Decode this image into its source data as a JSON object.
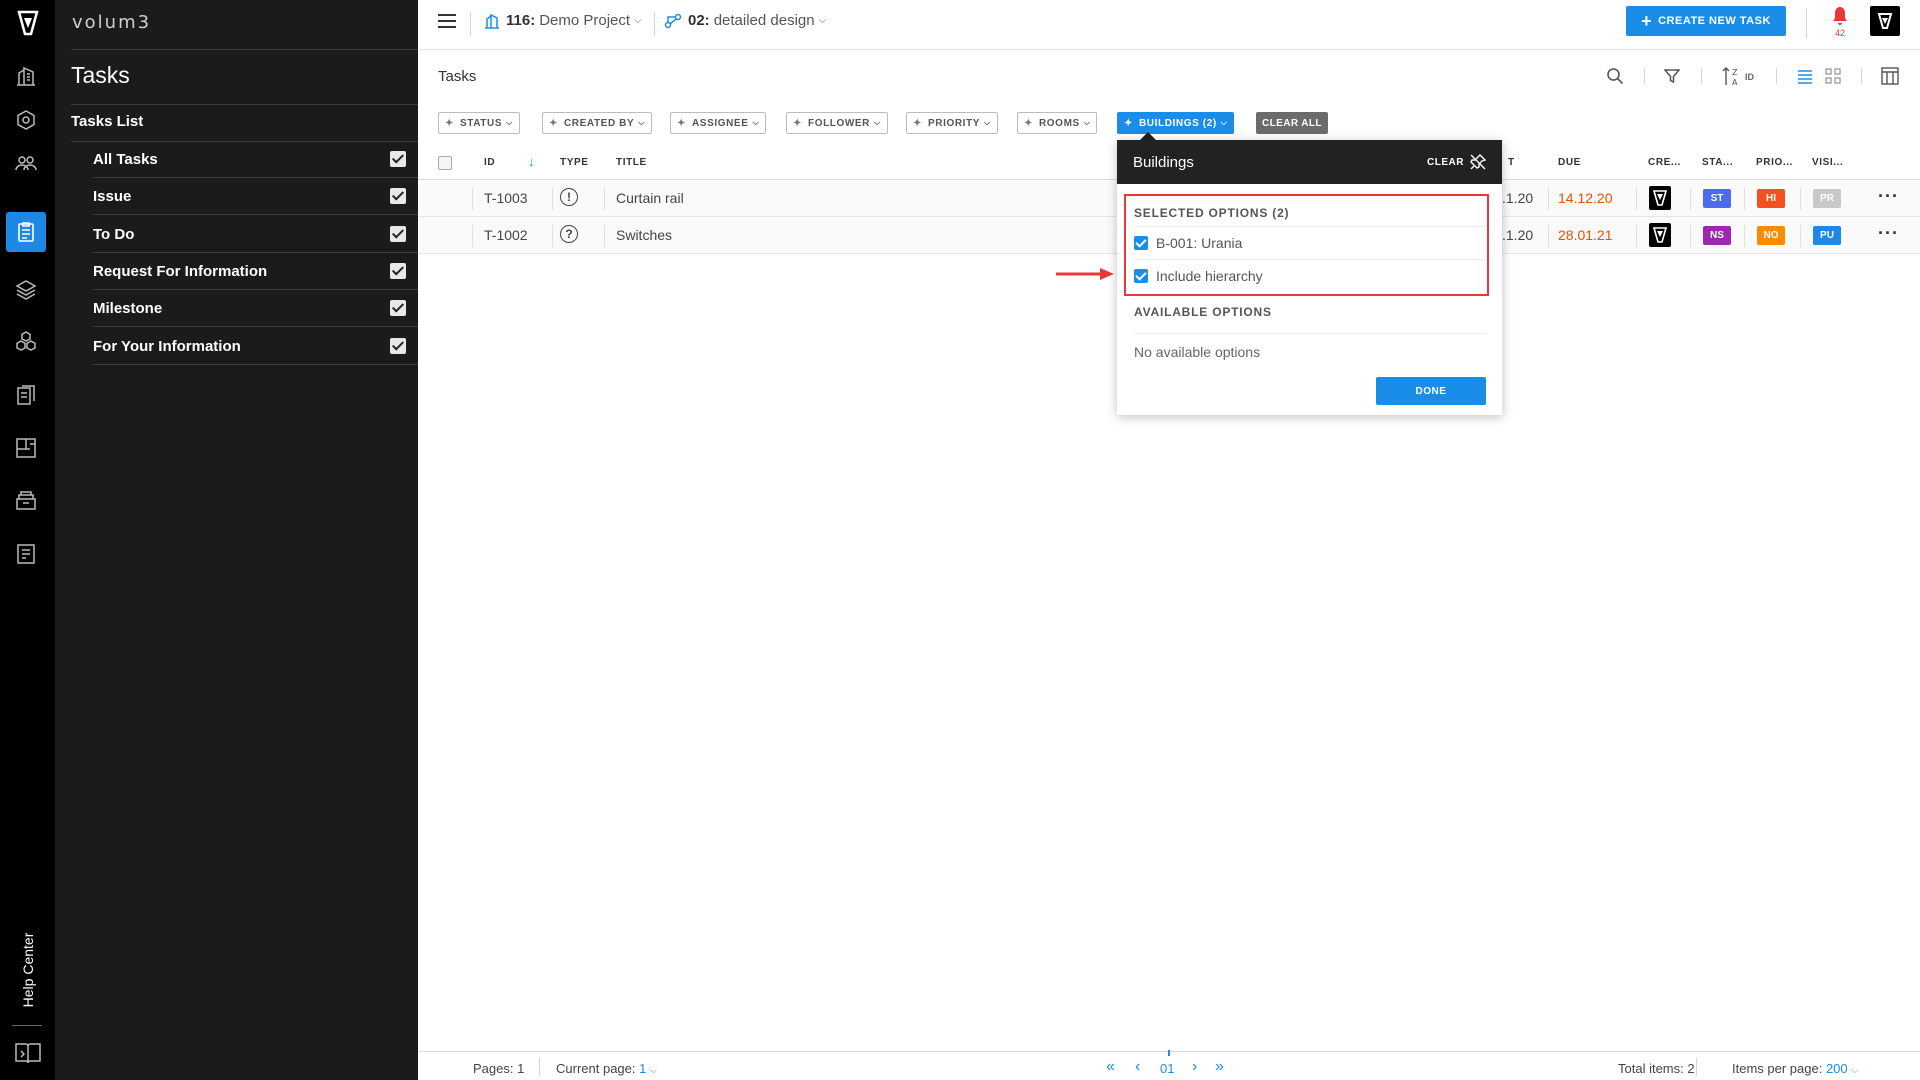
{
  "app": {
    "brand": "volum3"
  },
  "topbar": {
    "project_id": "116:",
    "project_name": "Demo Project",
    "phase_id": "02:",
    "phase_name": "detailed design",
    "create_button": "CREATE NEW TASK",
    "notification_count": "42"
  },
  "sidebar": {
    "title": "Tasks",
    "list_title": "Tasks List",
    "items": [
      {
        "label": "All Tasks"
      },
      {
        "label": "Issue"
      },
      {
        "label": "To Do"
      },
      {
        "label": "Request For Information"
      },
      {
        "label": "Milestone"
      },
      {
        "label": "For Your Information"
      }
    ],
    "help_center": "Help Center"
  },
  "main": {
    "title": "Tasks",
    "sort_label": "ID"
  },
  "filters": {
    "chips": [
      "STATUS",
      "CREATED BY",
      "ASSIGNEE",
      "FOLLOWER",
      "PRIORITY",
      "ROOMS",
      "BUILDINGS (2)"
    ],
    "clear_all": "CLEAR ALL"
  },
  "table": {
    "headers": {
      "id": "ID",
      "type": "TYPE",
      "title": "TITLE",
      "start": "T",
      "due": "DUE",
      "creator": "CRE...",
      "status": "STA...",
      "priority": "PRIO...",
      "visibility": "VISI..."
    },
    "rows": [
      {
        "id": "T-1003",
        "type_glyph": "!",
        "title": "Curtain rail",
        "start": ".1.20",
        "due": "14.12.20",
        "status": "ST",
        "status_color": "#4f6bed",
        "priority": "HI",
        "priority_color": "#f4511e",
        "visibility": "PR",
        "visibility_color": "#c8c8c8"
      },
      {
        "id": "T-1002",
        "type_glyph": "?",
        "title": "Switches",
        "start": ".1.20",
        "due": "28.01.21",
        "status": "NS",
        "status_color": "#9c27b0",
        "priority": "NO",
        "priority_color": "#fb8c00",
        "visibility": "PU",
        "visibility_color": "#1e88e5"
      }
    ]
  },
  "dropdown": {
    "title": "Buildings",
    "clear": "CLEAR",
    "selected_header": "SELECTED OPTIONS (2)",
    "selected": [
      {
        "label": "B-001: Urania"
      },
      {
        "label": "Include hierarchy"
      }
    ],
    "available_header": "AVAILABLE OPTIONS",
    "empty_text": "No available options",
    "done": "DONE"
  },
  "footer": {
    "pages_label": "Pages:",
    "pages_value": "1",
    "current_label": "Current page:",
    "current_value": "1",
    "page_indicator": "01",
    "total_label": "Total items:",
    "total_value": "2",
    "per_page_label": "Items per page:",
    "per_page_value": "200"
  },
  "colors": {
    "accent": "#1a8de9",
    "highlight_box": "#e53935",
    "due_overdue": "#e65100"
  },
  "icons": [
    "logo-icon",
    "buildings-icon",
    "settings-cube-icon",
    "team-icon",
    "tasks-icon",
    "layers-icon",
    "cubes-icon",
    "documents-icon",
    "floorplan-icon",
    "archive-icon",
    "report-icon",
    "help-book-icon",
    "search-icon",
    "filter-icon",
    "sort-az-icon",
    "list-view-icon",
    "grid-view-icon",
    "columns-icon",
    "bell-icon"
  ]
}
